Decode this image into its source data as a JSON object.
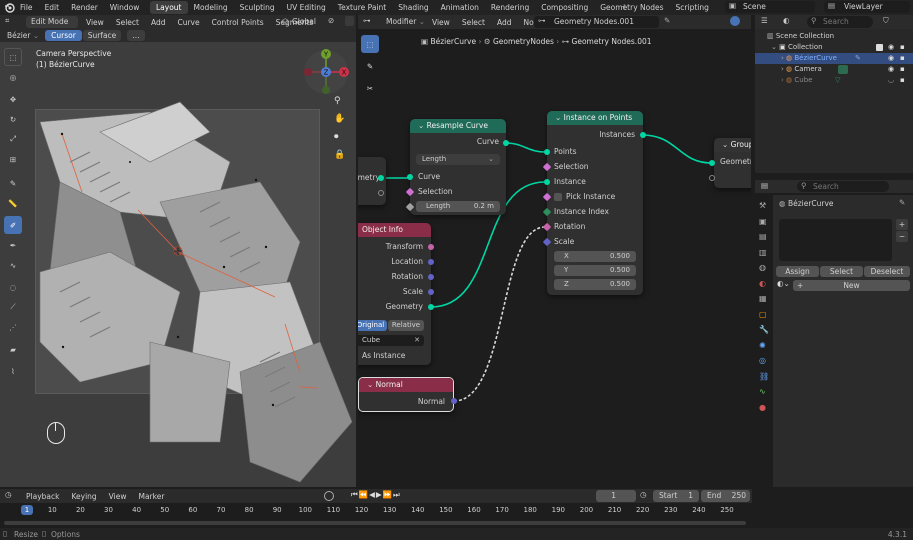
{
  "topbar": {
    "menus": [
      "File",
      "Edit",
      "Render",
      "Window",
      "Help"
    ],
    "workspaces": [
      "Layout",
      "Modeling",
      "Sculpting",
      "UV Editing",
      "Texture Paint",
      "Shading",
      "Animation",
      "Rendering",
      "Compositing",
      "Geometry Nodes",
      "Scripting"
    ],
    "active_workspace": "Layout",
    "scene": "Scene",
    "view_layer": "ViewLayer"
  },
  "viewport": {
    "mode": "Edit Mode",
    "menus": [
      "View",
      "Select",
      "Add",
      "Curve",
      "Control Points",
      "Segments"
    ],
    "transform": "Global",
    "sub_tabs": [
      "Bézier",
      "Cursor",
      "Surface"
    ],
    "active_sub_tab": "Cursor",
    "more": "...",
    "camera_label": "Camera Perspective",
    "object_label": "(1) BézierCurve",
    "axes": [
      "Y",
      "Z",
      "X"
    ]
  },
  "node_editor": {
    "type": "Modifier",
    "menus": [
      "View",
      "Select",
      "Add",
      "Node"
    ],
    "tree": "Geometry Nodes.001",
    "breadcrumb": [
      "BézierCurve",
      "GeometryNodes",
      "Geometry Nodes.001"
    ]
  },
  "nodes": {
    "resample": {
      "title": "Resample Curve",
      "out": "Curve",
      "mode": "Length",
      "in_curve": "Curve",
      "in_selection": "Selection",
      "length_label": "Length",
      "length_value": "0.2 m"
    },
    "instance": {
      "title": "Instance on Points",
      "out": "Instances",
      "points": "Points",
      "selection": "Selection",
      "instance": "Instance",
      "pick": "Pick Instance",
      "index": "Instance Index",
      "rotation": "Rotation",
      "scale": "Scale",
      "x_label": "X",
      "x": "0.500",
      "y_label": "Y",
      "y": "0.500",
      "z_label": "Z",
      "z": "0.500"
    },
    "group": {
      "title": "Group",
      "geometry": "Geometry"
    },
    "partial": {
      "geometry": "metry"
    },
    "object_info": {
      "title": "Object Info",
      "outputs": [
        "Transform",
        "Location",
        "Rotation",
        "Scale",
        "Geometry"
      ],
      "tab_original": "Original",
      "tab_relative": "Relative",
      "object": "Cube",
      "as_instance": "As Instance"
    },
    "normal": {
      "title": "Normal",
      "out": "Normal"
    }
  },
  "outliner": {
    "search": "Search",
    "items": [
      {
        "label": "Scene Collection"
      },
      {
        "label": "Collection"
      },
      {
        "label": "BézierCurve"
      },
      {
        "label": "Camera"
      },
      {
        "label": "Cube"
      }
    ]
  },
  "properties": {
    "search": "Search",
    "object": "BézierCurve",
    "assign": "Assign",
    "select": "Select",
    "deselect": "Deselect",
    "new": "New"
  },
  "timeline": {
    "menus": [
      "Playback",
      "Keying",
      "View",
      "Marker"
    ],
    "frame": "1",
    "start_label": "Start",
    "start": "1",
    "end_label": "End",
    "end": "250",
    "ticks": [
      "1",
      "10",
      "20",
      "30",
      "40",
      "50",
      "60",
      "70",
      "80",
      "90",
      "100",
      "110",
      "120",
      "130",
      "140",
      "150",
      "160",
      "170",
      "180",
      "190",
      "200",
      "210",
      "220",
      "230",
      "240",
      "250"
    ],
    "current_frame": 1
  },
  "statusbar": {
    "resize": "Resize",
    "options": "Options",
    "version": "4.3.1"
  },
  "colors": {
    "accent": "#4772b3",
    "geometry_socket": "#00d6a3",
    "vector_socket": "#6363c7",
    "float_socket": "#a1a1a1",
    "matrix_socket": "#c764a9",
    "resample_header": "#1f6b58",
    "object_info_header": "#8a2d48",
    "normal_header": "#8a2d48"
  }
}
